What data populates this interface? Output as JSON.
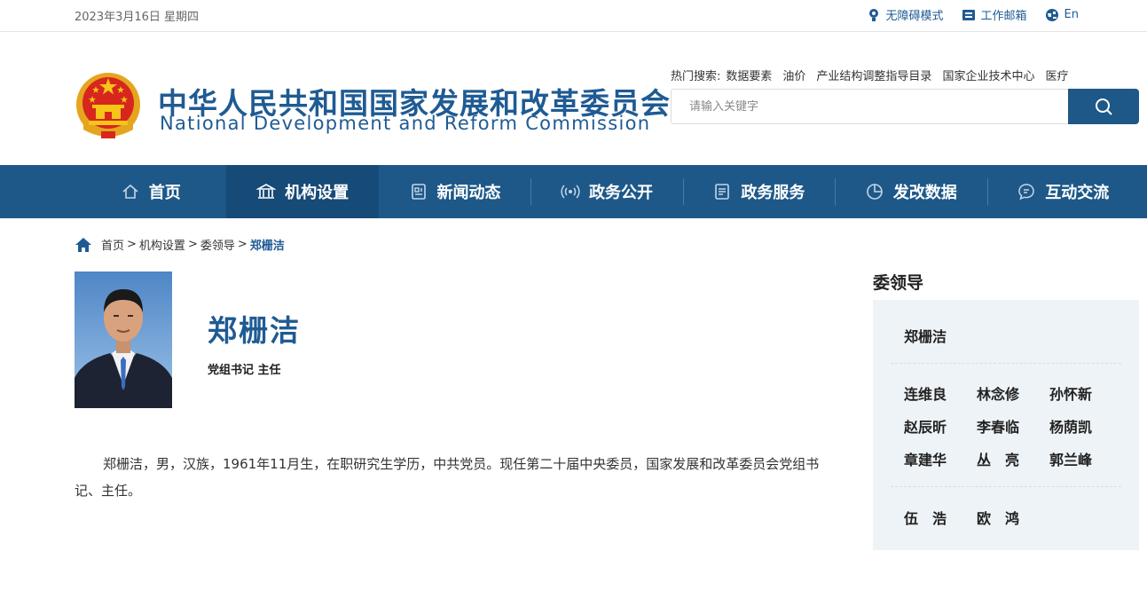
{
  "topbar": {
    "date": "2023年3月16日 星期四",
    "links": [
      {
        "label": "无障碍模式",
        "icon": "accessibility-icon"
      },
      {
        "label": "工作邮箱",
        "icon": "mail-icon"
      },
      {
        "label": "En",
        "icon": "globe-icon"
      }
    ]
  },
  "header": {
    "title_cn": "中华人民共和国国家发展和改革委员会",
    "title_en": "National Development and Reform Commission",
    "hot_label": "热门搜索:",
    "hot_terms": [
      "数据要素",
      "油价",
      "产业结构调整指导目录",
      "国家企业技术中心",
      "医疗"
    ],
    "search_placeholder": "请输入关键字"
  },
  "nav": {
    "items": [
      {
        "label": "首页",
        "icon": "home-icon"
      },
      {
        "label": "机构设置",
        "icon": "institution-icon"
      },
      {
        "label": "新闻动态",
        "icon": "news-icon"
      },
      {
        "label": "政务公开",
        "icon": "broadcast-icon"
      },
      {
        "label": "政务服务",
        "icon": "document-icon"
      },
      {
        "label": "发改数据",
        "icon": "pie-chart-icon"
      },
      {
        "label": "互动交流",
        "icon": "chat-icon"
      }
    ],
    "active": "机构设置"
  },
  "breadcrumb": {
    "items": [
      "首页",
      "机构设置",
      "委领导"
    ],
    "current": "郑栅洁",
    "separator": ">"
  },
  "profile": {
    "name": "郑栅洁",
    "position": "党组书记 主任",
    "bio": "郑栅洁，男，汉族，1961年11月生，在职研究生学历，中共党员。现任第二十届中央委员，国家发展和改革委员会党组书记、主任。"
  },
  "sidebar": {
    "title": "委领导",
    "main": "郑栅洁",
    "deputies": [
      "连维良",
      "林念修",
      "孙怀新",
      "赵辰昕",
      "李春临",
      "杨荫凯",
      "章建华",
      "丛　亮",
      "郭兰峰"
    ],
    "others": [
      "伍　浩",
      "欧　鸿"
    ]
  },
  "colors": {
    "brand": "#1f5b93",
    "nav_bg": "#1d5889",
    "nav_active": "#164a77",
    "sidebar_bg": "#eef3f7"
  }
}
